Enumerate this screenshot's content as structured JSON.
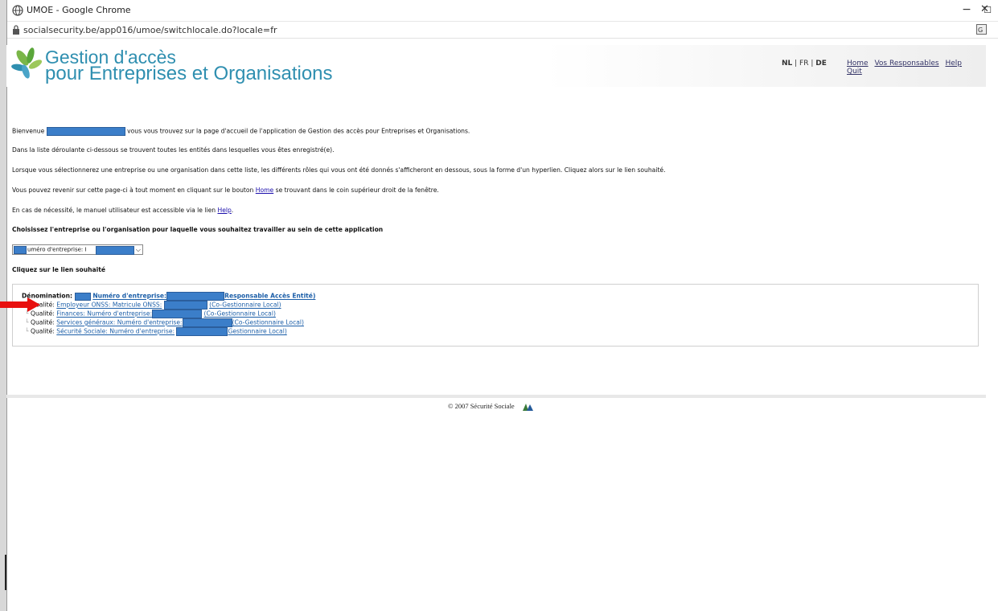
{
  "browser": {
    "title": "UMOE - Google Chrome",
    "url": "socialsecurity.be/app016/umoe/switchlocale.do?locale=fr",
    "controls": [
      "−",
      "☐",
      "✕"
    ]
  },
  "header": {
    "brand_line1": "Gestion d'accès",
    "brand_line2": "pour Entreprises et Organisations",
    "langs": {
      "nl": "NL",
      "sep1": " | ",
      "fr": "FR",
      "sep2": " | ",
      "de": "DE"
    },
    "links": [
      "Home",
      "Vos Responsables",
      "Help",
      "Quit"
    ]
  },
  "intro": {
    "welcome_prefix": "Bienvenue",
    "welcome_suffix": "vous vous trouvez sur la page d'accueil de l'application de Gestion des accès pour Entreprises et Organisations.",
    "line2": "Dans la liste déroulante ci-dessous se trouvent toutes les entités dans lesquelles vous êtes enregistré(e).",
    "line3": "Lorsque vous sélectionnerez une entreprise ou une organisation dans cette liste, les différents rôles qui vous ont été donnés s'afficheront en dessous, sous la forme d'un hyperlien. Cliquez alors sur le lien souhaité.",
    "line4_prefix": "Vous pouvez revenir sur cette page-ci à tout moment en cliquant sur le bouton",
    "line4_link": "Home",
    "line4_suffix": "se trouvant dans le coin supérieur droit de la fenêtre.",
    "line5_prefix": "En cas de nécessité, le manuel utilisateur est accessible via le lien",
    "line5_link": "Help",
    "line5_suffix": ".",
    "choose_heading": "Choisissez l'entreprise ou l'organisation pour laquelle vous souhaitez travailler au sein de cette application",
    "select_value": "uméro d'entreprise: I",
    "click_heading": "Cliquez sur le lien souhaité"
  },
  "panel": {
    "denomination_label": "Dénomination:",
    "denomination_link1": "Numéro d'entreprise:",
    "denomination_link2": "Responsable Accès Entité)",
    "rows": [
      {
        "label": "Qualité:",
        "link1": "Employeur ONSS: Matricule ONSS:",
        "link2": "(Co-Gestionnaire Local)"
      },
      {
        "label": "Qualité:",
        "link1": "Finances: Numéro d'entreprise:",
        "link2": "(Co-Gestionnaire Local)"
      },
      {
        "label": "Qualité:",
        "link1": "Services généraux: Numéro d'entreprise:",
        "link2": "(Co-Gestionnaire Local)"
      },
      {
        "label": "Qualité:",
        "link1": "Sécurité Sociale: Numéro d'entreprise:",
        "link2": "Gestionnaire Local)"
      }
    ]
  },
  "footer": {
    "copyright": "© 2007 Sécurité Sociale"
  },
  "colors": {
    "brand": "#2f8fb0",
    "link": "#1b5ea8",
    "redaction": "#3b7ec9",
    "arrow": "#e8100f"
  }
}
